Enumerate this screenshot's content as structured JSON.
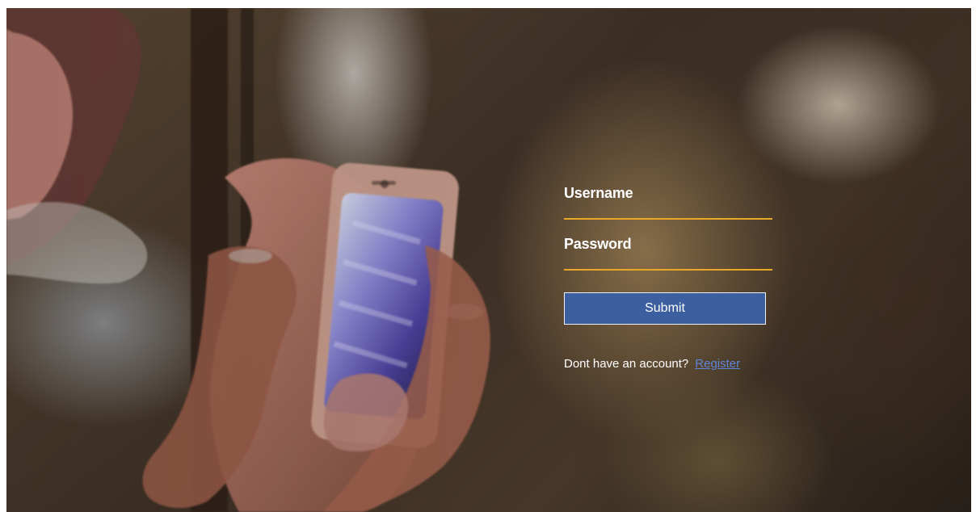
{
  "login_form": {
    "username_label": "Username",
    "password_label": "Password",
    "submit_label": "Submit",
    "account_prompt": "Dont have an account?",
    "register_link": "Register"
  },
  "colors": {
    "input_underline": "#e8a825",
    "submit_background": "#3b5f9f",
    "register_link": "#5f86d6"
  }
}
